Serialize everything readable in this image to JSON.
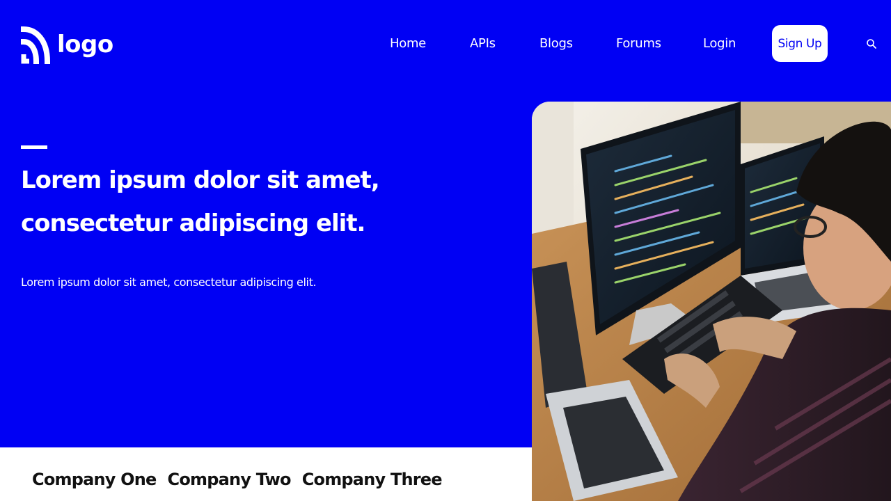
{
  "header": {
    "logo_text": "logo",
    "nav": [
      {
        "label": "Home"
      },
      {
        "label": "APIs"
      },
      {
        "label": "Blogs"
      },
      {
        "label": "Forums"
      },
      {
        "label": "Login"
      }
    ],
    "signup_label": "Sign Up",
    "search_icon": "search-icon"
  },
  "hero": {
    "title_line1": "Lorem ipsum dolor sit amet,",
    "title_line2": "consectetur adipiscing elit.",
    "subtitle": "Lorem ipsum dolor sit amet, consectetur adipiscing elit.",
    "image_subject": "developer-at-desk-photo"
  },
  "companies": [
    {
      "name": "Company One"
    },
    {
      "name": "Company Two"
    },
    {
      "name": "Company Three"
    }
  ],
  "colors": {
    "brand_blue": "#0000f4",
    "text_on_brand": "#ffffff",
    "page_background": "#ffffff"
  }
}
